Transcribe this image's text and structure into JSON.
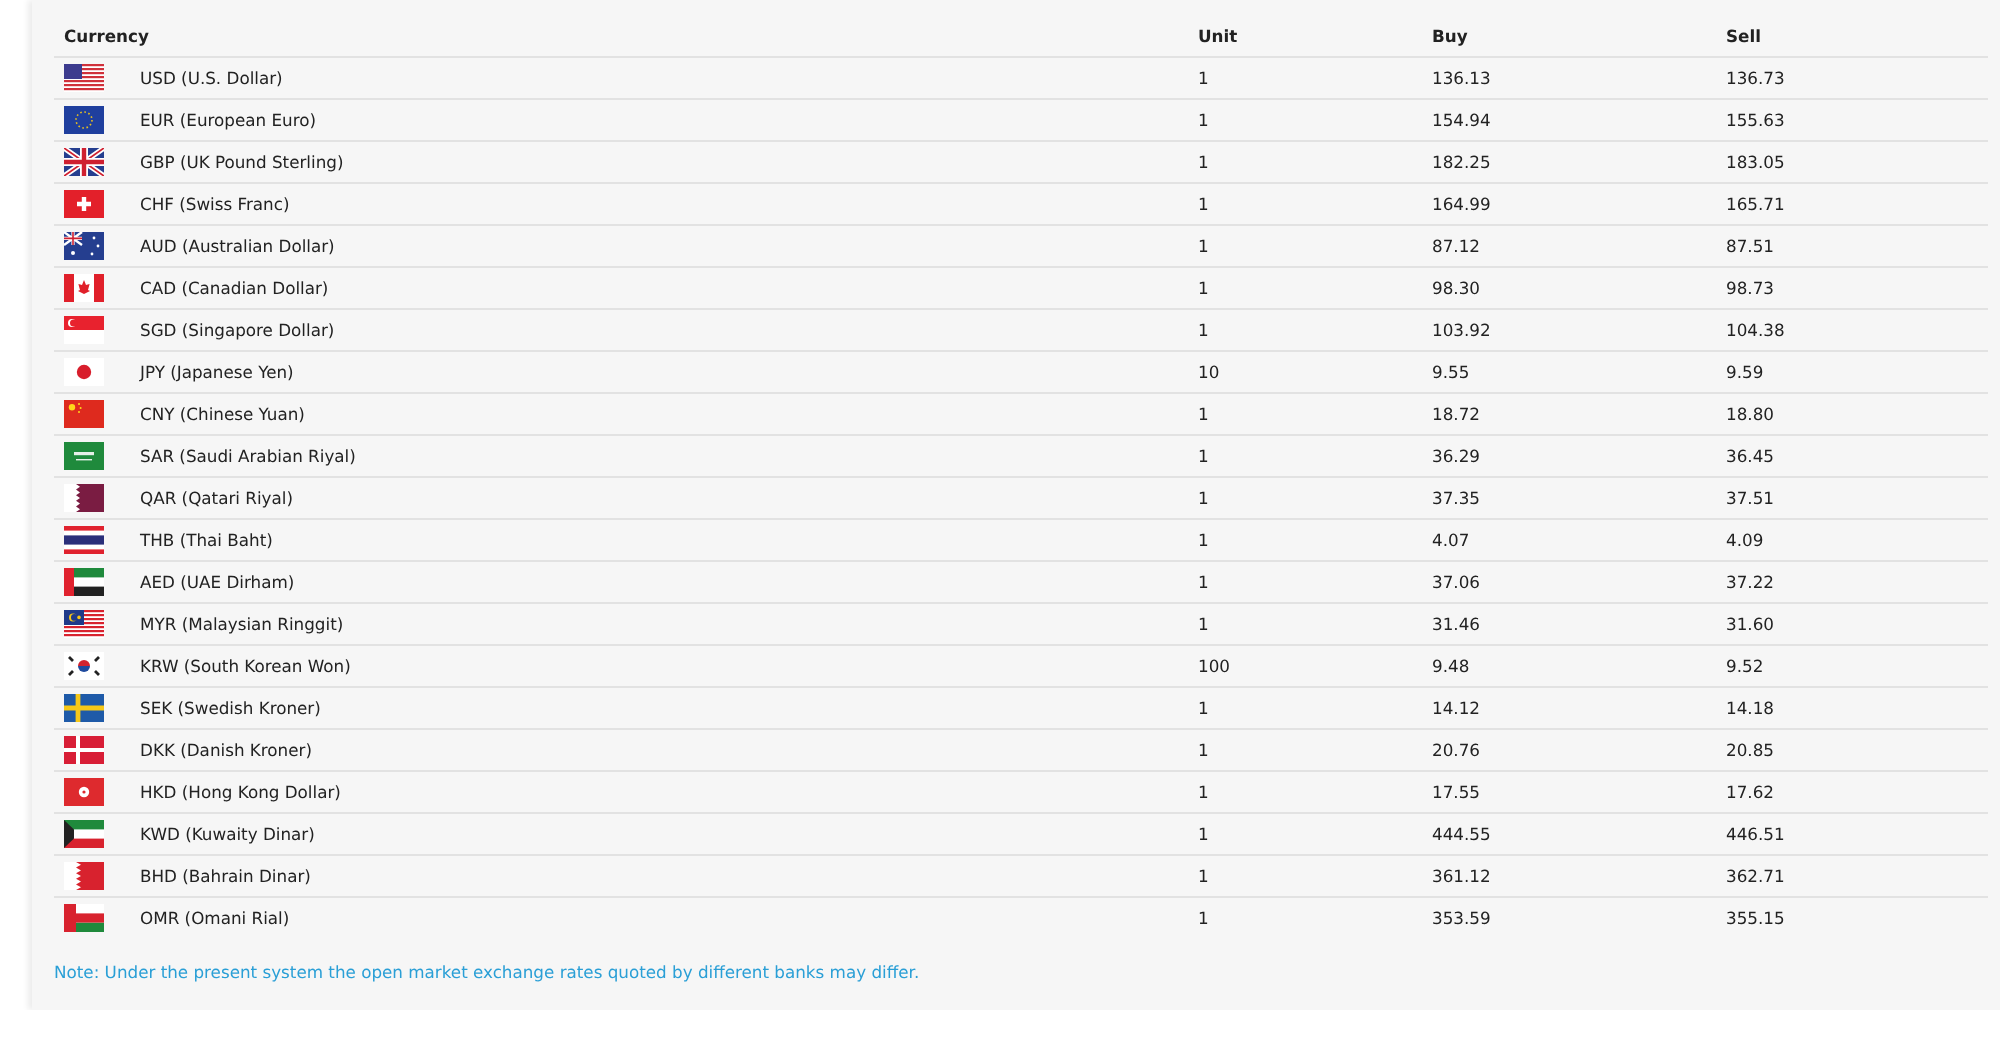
{
  "table": {
    "columns": [
      "Currency",
      "Unit",
      "Buy",
      "Sell"
    ],
    "rows": [
      {
        "kind": "us",
        "currency": "USD (U.S. Dollar)",
        "unit": "1",
        "buy": "136.13",
        "sell": "136.73"
      },
      {
        "kind": "eu",
        "currency": "EUR (European Euro)",
        "unit": "1",
        "buy": "154.94",
        "sell": "155.63"
      },
      {
        "kind": "gb",
        "currency": "GBP (UK Pound Sterling)",
        "unit": "1",
        "buy": "182.25",
        "sell": "183.05"
      },
      {
        "kind": "ch",
        "currency": "CHF (Swiss Franc)",
        "unit": "1",
        "buy": "164.99",
        "sell": "165.71"
      },
      {
        "kind": "au",
        "currency": "AUD (Australian Dollar)",
        "unit": "1",
        "buy": "87.12",
        "sell": "87.51"
      },
      {
        "kind": "ca",
        "currency": "CAD (Canadian Dollar)",
        "unit": "1",
        "buy": "98.30",
        "sell": "98.73"
      },
      {
        "kind": "sg",
        "currency": "SGD (Singapore Dollar)",
        "unit": "1",
        "buy": "103.92",
        "sell": "104.38"
      },
      {
        "kind": "jp",
        "currency": "JPY (Japanese Yen)",
        "unit": "10",
        "buy": "9.55",
        "sell": "9.59"
      },
      {
        "kind": "cn",
        "currency": "CNY (Chinese Yuan)",
        "unit": "1",
        "buy": "18.72",
        "sell": "18.80"
      },
      {
        "kind": "sa",
        "currency": "SAR (Saudi Arabian Riyal)",
        "unit": "1",
        "buy": "36.29",
        "sell": "36.45"
      },
      {
        "kind": "qa",
        "currency": "QAR (Qatari Riyal)",
        "unit": "1",
        "buy": "37.35",
        "sell": "37.51"
      },
      {
        "kind": "th",
        "currency": "THB (Thai Baht)",
        "unit": "1",
        "buy": "4.07",
        "sell": "4.09"
      },
      {
        "kind": "ae",
        "currency": "AED (UAE Dirham)",
        "unit": "1",
        "buy": "37.06",
        "sell": "37.22"
      },
      {
        "kind": "my",
        "currency": "MYR (Malaysian Ringgit)",
        "unit": "1",
        "buy": "31.46",
        "sell": "31.60"
      },
      {
        "kind": "kr",
        "currency": "KRW (South Korean Won)",
        "unit": "100",
        "buy": "9.48",
        "sell": "9.52"
      },
      {
        "kind": "se",
        "currency": "SEK (Swedish Kroner)",
        "unit": "1",
        "buy": "14.12",
        "sell": "14.18"
      },
      {
        "kind": "dk",
        "currency": "DKK (Danish Kroner)",
        "unit": "1",
        "buy": "20.76",
        "sell": "20.85"
      },
      {
        "kind": "hk",
        "currency": "HKD (Hong Kong Dollar)",
        "unit": "1",
        "buy": "17.55",
        "sell": "17.62"
      },
      {
        "kind": "kw",
        "currency": "KWD (Kuwaity Dinar)",
        "unit": "1",
        "buy": "444.55",
        "sell": "446.51"
      },
      {
        "kind": "bh",
        "currency": "BHD (Bahrain Dinar)",
        "unit": "1",
        "buy": "361.12",
        "sell": "362.71"
      },
      {
        "kind": "om",
        "currency": "OMR (Omani Rial)",
        "unit": "1",
        "buy": "353.59",
        "sell": "355.15"
      }
    ]
  },
  "note": "Note: Under the present system the open market exchange rates quoted by different banks may differ."
}
